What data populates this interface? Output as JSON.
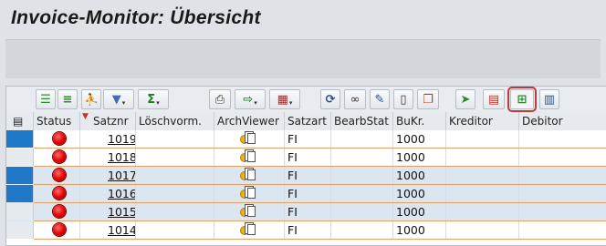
{
  "window": {
    "title": "Invoice-Monitor: Übersicht"
  },
  "toolbar": {
    "buttons": [
      {
        "name": "details-icon",
        "glyph": "☰",
        "color": "#2e8b2e"
      },
      {
        "name": "sort-ascending-icon",
        "glyph": "≡",
        "color": "#2e8b2e"
      },
      {
        "name": "find-icon",
        "glyph": "🔍",
        "color": "#335e9e"
      },
      {
        "name": "filter-icon",
        "glyph": "▼",
        "color": "#3e6fb5"
      },
      {
        "name": "sum-icon",
        "glyph": "Σ",
        "color": "#1e7a1e"
      },
      {
        "name": "print-icon",
        "glyph": "🖶",
        "color": "#333"
      },
      {
        "name": "export-icon",
        "glyph": "⇨",
        "color": "#2e8b2e"
      },
      {
        "name": "layout-icon",
        "glyph": "▦",
        "color": "#9c2e2e"
      },
      {
        "name": "refresh-icon",
        "glyph": "⟳",
        "color": "#2b4f8f"
      },
      {
        "name": "glasses-icon",
        "glyph": "∞",
        "color": "#333"
      },
      {
        "name": "edit-icon",
        "glyph": "✎",
        "color": "#2b4f8f"
      },
      {
        "name": "new-document-icon",
        "glyph": "🗋",
        "color": "#333"
      },
      {
        "name": "copy-icon",
        "glyph": "❐",
        "color": "#c0392b"
      },
      {
        "name": "forward-icon",
        "glyph": "➤",
        "color": "#2e8b2e"
      },
      {
        "name": "calendar-icon",
        "glyph": "▤",
        "color": "#c0392b"
      },
      {
        "name": "hierarchy-icon",
        "glyph": "⊞",
        "color": "#2e8b2e"
      },
      {
        "name": "delete-icon",
        "glyph": "🗑",
        "color": "#2b4f8f"
      }
    ]
  },
  "table": {
    "columns": [
      "Status",
      "Satznr",
      "Löschvorm.",
      "ArchViewer",
      "Satzart",
      "BearbStat",
      "BuKr.",
      "Kreditor",
      "Debitor"
    ],
    "rows": [
      {
        "satznr": "1019",
        "satzart": "FI",
        "bukr": "1000",
        "selected": true,
        "rowbg": "#ffffff"
      },
      {
        "satznr": "1018",
        "satzart": "FI",
        "bukr": "1000",
        "selected": false,
        "rowbg": "#ffffff"
      },
      {
        "satznr": "1017",
        "satzart": "FI",
        "bukr": "1000",
        "selected": true,
        "rowbg": "#dce6f1"
      },
      {
        "satznr": "1016",
        "satzart": "FI",
        "bukr": "1000",
        "selected": true,
        "rowbg": "#dce6f1"
      },
      {
        "satznr": "1015",
        "satzart": "FI",
        "bukr": "1000",
        "selected": false,
        "rowbg": "#dce6f1"
      },
      {
        "satznr": "1014",
        "satzart": "FI",
        "bukr": "1000",
        "selected": false,
        "rowbg": "#ffffff"
      }
    ]
  },
  "colors": {
    "selection": "#1f78c8",
    "rowline": "#e2a064",
    "status_red": "#e00000"
  }
}
